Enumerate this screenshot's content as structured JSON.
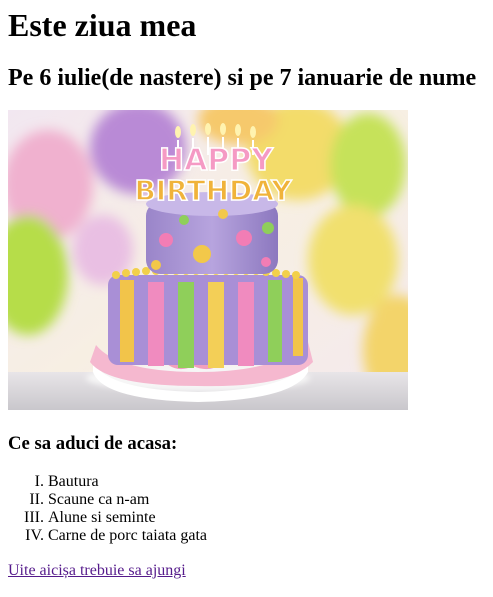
{
  "title": "Este ziua mea",
  "subtitle": "Pe 6 iulie(de nastere) si pe 7 ianuarie de nume",
  "image": {
    "topper_line1": "HAPPY",
    "topper_line2": "BIRTHDAY"
  },
  "list_heading": "Ce sa aduci de acasa:",
  "items": [
    "Bautura",
    "Scaune ca n-am",
    "Alune si seminte",
    "Carne de porc taiata gata"
  ],
  "link_text": "Uite aicișa trebuie sa ajungi",
  "colors": {
    "link": "#551a8b",
    "text": "#000000"
  }
}
